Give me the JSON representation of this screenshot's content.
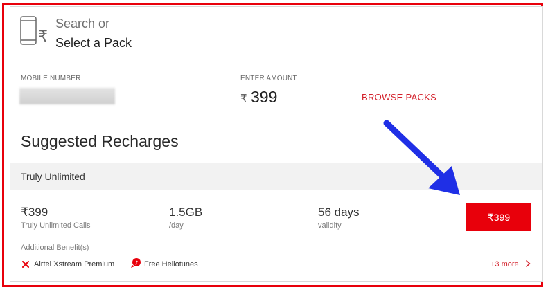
{
  "header": {
    "line1": "Search or",
    "line2": "Select a Pack"
  },
  "form": {
    "mobile_label": "MOBILE NUMBER",
    "amount_label": "ENTER AMOUNT",
    "currency_symbol": "₹",
    "amount_value": "399",
    "browse_label": "BROWSE PACKS"
  },
  "suggested": {
    "title": "Suggested Recharges",
    "category": "Truly Unlimited",
    "pack": {
      "price": "₹399",
      "price_sub": "Truly Unlimited Calls",
      "data": "1.5GB",
      "data_sub": "/day",
      "validity": "56 days",
      "validity_sub": "validity",
      "button_label": "₹399",
      "benefits_title": "Additional Benefit(s)",
      "benefits": [
        "Airtel Xstream Premium",
        "Free Hellotunes"
      ],
      "more_label": "+3 more"
    }
  },
  "colors": {
    "brand_red": "#e8000b",
    "arrow_blue": "#1f2fe6"
  },
  "icons": [
    "phone-rupee-icon",
    "xstream-icon",
    "hellotunes-icon",
    "chevron-right-icon",
    "annotation-arrow"
  ]
}
